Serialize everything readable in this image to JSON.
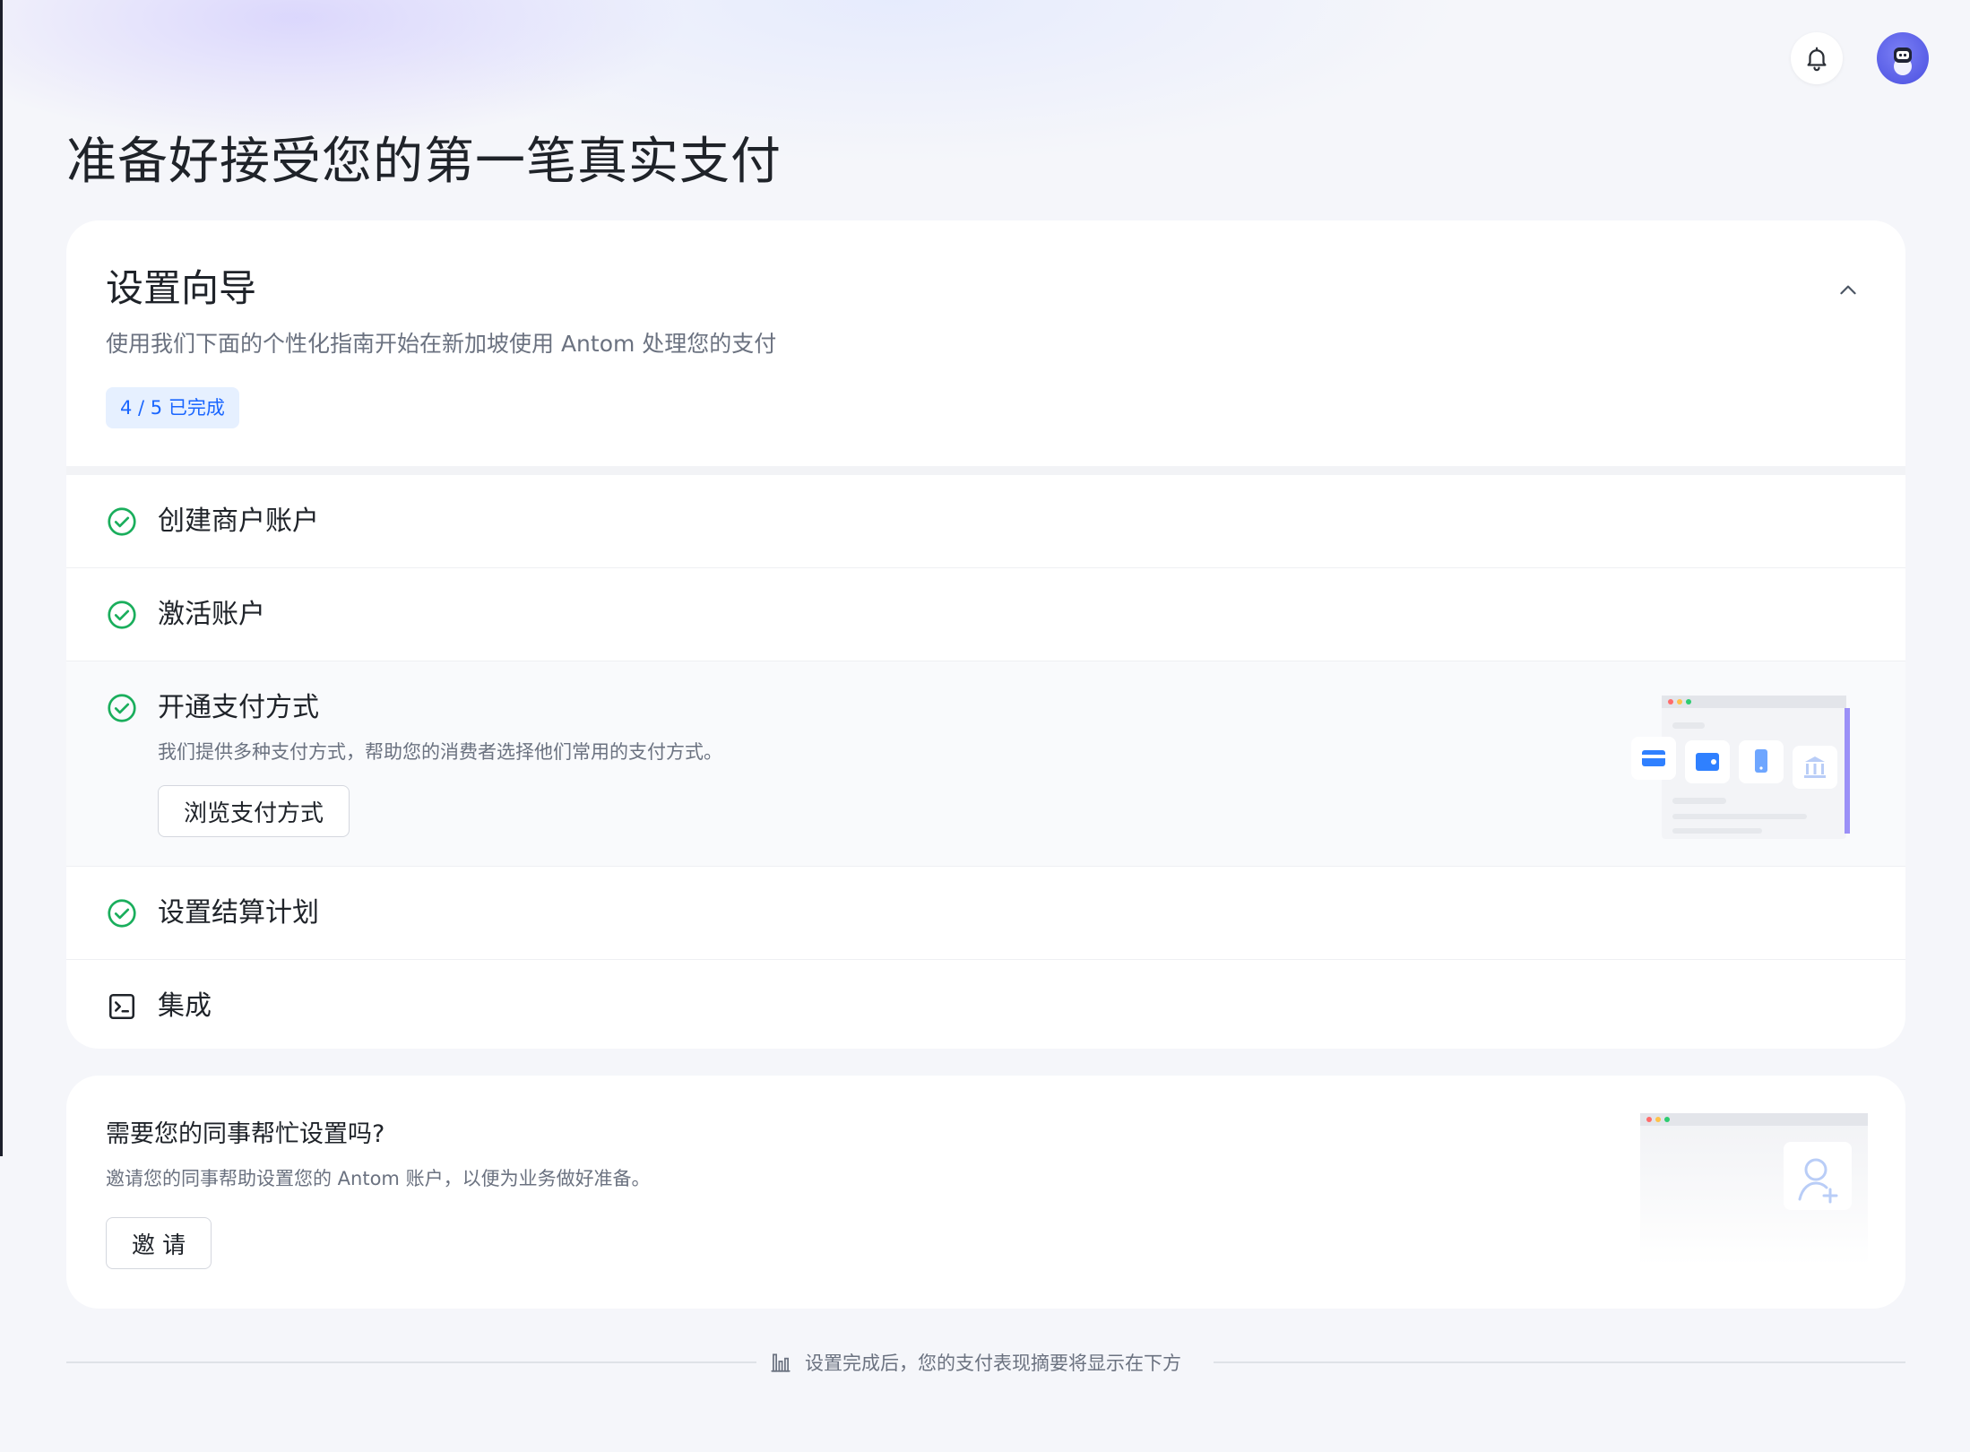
{
  "page": {
    "title": "准备好接受您的第一笔真实支付"
  },
  "topbar": {
    "bell_icon": "bell-icon",
    "avatar_icon": "robot-avatar-icon"
  },
  "wizard": {
    "title": "设置向导",
    "subtitle": "使用我们下面的个性化指南开始在新加坡使用 Antom 处理您的支付",
    "progress": "4 / 5 已完成",
    "collapse_icon": "chevron-up-icon",
    "steps": [
      {
        "label": "创建商户账户",
        "status": "completed"
      },
      {
        "label": "激活账户",
        "status": "completed"
      },
      {
        "label": "开通支付方式",
        "status": "completed",
        "description": "我们提供多种支付方式，帮助您的消费者选择他们常用的支付方式。",
        "button": "浏览支付方式"
      },
      {
        "label": "设置结算计划",
        "status": "completed"
      },
      {
        "label": "集成",
        "status": "pending"
      }
    ]
  },
  "invite": {
    "title": "需要您的同事帮忙设置吗?",
    "description": "邀请您的同事帮助设置您的 Antom 账户，以便为业务做好准备。",
    "button": "邀 请"
  },
  "footer": {
    "text": "设置完成后，您的支付表现摘要将显示在下方",
    "icon": "bar-chart-icon"
  },
  "colors": {
    "accent": "#1a66ff",
    "success": "#1aae5c",
    "badge_bg": "#e6f0ff",
    "page_bg": "#f5f6fa"
  }
}
